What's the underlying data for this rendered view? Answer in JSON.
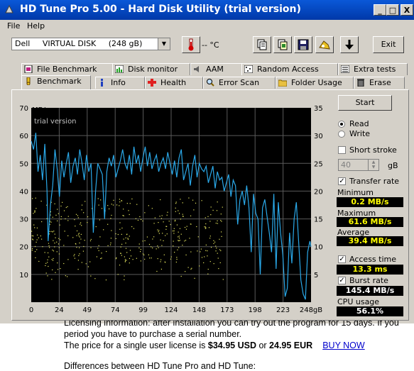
{
  "window": {
    "title": "HD Tune Pro 5.00 - Hard Disk Utility (trial version)",
    "controls": [
      "_",
      "□",
      "X"
    ]
  },
  "menu": {
    "items": [
      "File",
      "Help"
    ]
  },
  "toolbar": {
    "drive": "Dell     VIRTUAL DISK     (248 gB)",
    "temperature": "-- °C",
    "exit_label": "Exit",
    "icons": [
      "thermometer-icon",
      "copy-text-icon",
      "copy-image-icon",
      "save-icon",
      "options-icon",
      "download-icon"
    ]
  },
  "tabs": {
    "row1": [
      "File Benchmark",
      "Disk monitor",
      "AAM",
      "Random Access",
      "Extra tests"
    ],
    "row2": [
      "Benchmark",
      "Info",
      "Health",
      "Error Scan",
      "Folder Usage",
      "Erase"
    ],
    "active": "Benchmark"
  },
  "controls": {
    "start_label": "Start",
    "read_label": "Read",
    "write_label": "Write",
    "selected_mode": "Read",
    "short_stroke_label": "Short stroke",
    "short_stroke_checked": false,
    "short_stroke_value": "40",
    "short_stroke_unit": "gB",
    "transfer_rate_label": "Transfer rate",
    "transfer_rate_checked": true,
    "minimum_label": "Minimum",
    "minimum_value": "0.2 MB/s",
    "maximum_label": "Maximum",
    "maximum_value": "61.6 MB/s",
    "average_label": "Average",
    "average_value": "39.4 MB/s",
    "access_time_label": "Access time",
    "access_time_checked": true,
    "access_time_value": "13.3 ms",
    "burst_rate_label": "Burst rate",
    "burst_rate_checked": true,
    "burst_rate_value": "145.4 MB/s",
    "cpu_usage_label": "CPU usage",
    "cpu_usage_value": "56.1%"
  },
  "chart_data": {
    "type": "line",
    "watermark": "trial version",
    "left_axis_label": "MB/s",
    "right_axis_label": "ms",
    "left_ticks": [
      "10",
      "20",
      "30",
      "40",
      "50",
      "60",
      "70"
    ],
    "right_ticks": [
      "5",
      "10",
      "15",
      "20",
      "25",
      "30",
      "35"
    ],
    "x_ticks": [
      "0",
      "24",
      "49",
      "74",
      "99",
      "124",
      "148",
      "173",
      "198",
      "223",
      "248gB"
    ],
    "xlim": [
      0,
      248
    ],
    "ylim": [
      0,
      70
    ],
    "y2lim": [
      0,
      35
    ],
    "grid": true,
    "colors": {
      "background": "#000000",
      "grid": "#5a5a5a",
      "transfer": "#2aa8e8",
      "access": "#e8e860"
    },
    "series": [
      {
        "name": "Transfer rate",
        "x": [
          0,
          2,
          4,
          6,
          8,
          10,
          12,
          14,
          15,
          17,
          19,
          21,
          23,
          25,
          27,
          29,
          31,
          33,
          35,
          37,
          39,
          41,
          43,
          45,
          47,
          49,
          51,
          53,
          55,
          57,
          59,
          61,
          63,
          65,
          67,
          69,
          71,
          73,
          75,
          77,
          79,
          81,
          83,
          85,
          87,
          89,
          91,
          93,
          95,
          97,
          99,
          101,
          103,
          105,
          107,
          109,
          111,
          113,
          115,
          117,
          119,
          121,
          123,
          125,
          127,
          129,
          131,
          133,
          135,
          137,
          139,
          141,
          143,
          145,
          147,
          149,
          151,
          153,
          155,
          157,
          159,
          161,
          163,
          165,
          167,
          169,
          171,
          173,
          175,
          177,
          179,
          181,
          183,
          185,
          187,
          189,
          191,
          193,
          195,
          197,
          199,
          201,
          203,
          205,
          207,
          209,
          211,
          213,
          215,
          217,
          219,
          221,
          223,
          225,
          227,
          229,
          231,
          233,
          235,
          237,
          239,
          241,
          243,
          245,
          247,
          248
        ],
        "values": [
          58,
          55,
          61,
          47,
          53,
          44,
          57,
          40,
          22,
          35,
          42,
          55,
          48,
          38,
          51,
          45,
          50,
          54,
          43,
          49,
          52,
          46,
          55,
          50,
          44,
          53,
          47,
          50,
          25,
          40,
          50,
          48,
          46,
          30,
          47,
          52,
          49,
          53,
          45,
          48,
          51,
          55,
          50,
          48,
          53,
          46,
          56,
          50,
          53,
          47,
          52,
          56,
          49,
          54,
          48,
          51,
          53,
          47,
          50,
          52,
          48,
          54,
          50,
          46,
          51,
          45,
          52,
          55,
          44,
          47,
          50,
          42,
          49,
          53,
          45,
          50,
          48,
          47,
          49,
          43,
          46,
          49,
          41,
          47,
          44,
          45,
          40,
          43,
          46,
          38,
          44,
          42,
          28,
          37,
          40,
          35,
          42,
          34,
          18,
          39,
          32,
          30,
          10,
          34,
          37,
          31,
          25,
          18,
          39,
          12,
          36,
          25,
          17,
          2,
          5,
          25,
          14,
          30,
          36,
          22,
          8,
          3,
          1,
          18,
          22,
          20
        ]
      }
    ],
    "access_density_note": ""
  },
  "webpage": {
    "line1": "Licensing information: after installation you can try out the program for 15 days. If you",
    "line2": "period you have to purchase a serial number.",
    "line3_prefix": "The price for a single user license is ",
    "price_usd": "$34.95 USD",
    "line3_mid": " or ",
    "price_eur": "24.95 EUR",
    "buy_now": "BUY NOW",
    "line4": "Differences between HD Tune Pro and HD Tune:"
  }
}
